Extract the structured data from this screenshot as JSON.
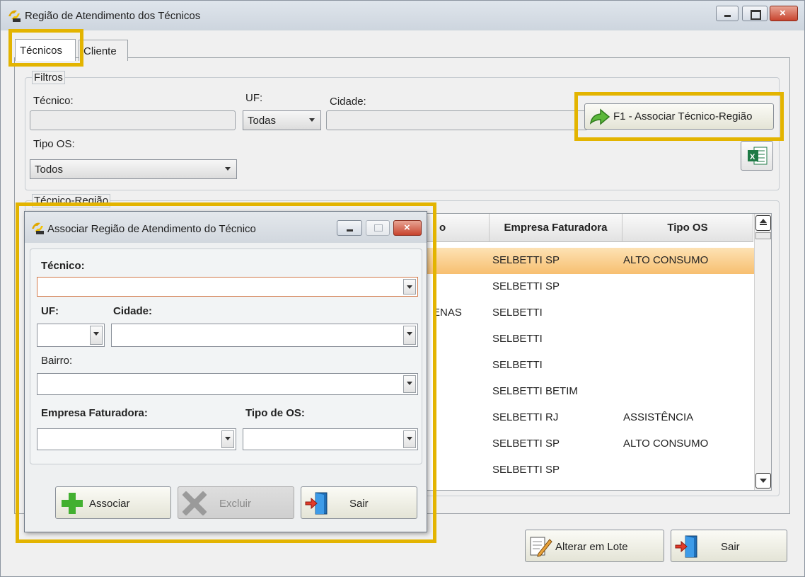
{
  "window": {
    "title": "Região de Atendimento dos Técnicos"
  },
  "tabs": [
    {
      "label": "Técnicos"
    },
    {
      "label": "Cliente"
    }
  ],
  "filters": {
    "legend": "Filtros",
    "tecnico_label": "Técnico:",
    "uf_label": "UF:",
    "uf_value": "Todas",
    "cidade_label": "Cidade:",
    "tipo_os_label": "Tipo OS:",
    "tipo_os_value": "Todos",
    "associate_button": "F1 - Associar Técnico-Região"
  },
  "region_group": {
    "legend": "Técnico-Região"
  },
  "grid": {
    "columns": {
      "partial": "o",
      "empresa": "Empresa Faturadora",
      "tipo": "Tipo OS"
    },
    "rows": [
      {
        "partial": "",
        "empresa": "SELBETTI SP",
        "tipo": "ALTO CONSUMO",
        "selected": true
      },
      {
        "partial": "",
        "empresa": "SELBETTI SP",
        "tipo": ""
      },
      {
        "partial": "ENAS",
        "empresa": "SELBETTI",
        "tipo": ""
      },
      {
        "partial": "",
        "empresa": "SELBETTI",
        "tipo": ""
      },
      {
        "partial": "",
        "empresa": "SELBETTI",
        "tipo": ""
      },
      {
        "partial": "",
        "empresa": "SELBETTI BETIM",
        "tipo": ""
      },
      {
        "partial": "",
        "empresa": "SELBETTI RJ",
        "tipo": "ASSISTÊNCIA"
      },
      {
        "partial": "",
        "empresa": "SELBETTI SP",
        "tipo": "ALTO CONSUMO"
      },
      {
        "partial": "",
        "empresa": "SELBETTI SP",
        "tipo": ""
      }
    ]
  },
  "footer": {
    "alterar_lote": "Alterar em Lote",
    "sair": "Sair"
  },
  "dialog": {
    "title": "Associar Região de Atendimento do Técnico",
    "tecnico_label": "Técnico:",
    "uf_label": "UF:",
    "cidade_label": "Cidade:",
    "bairro_label": "Bairro:",
    "empresa_label": "Empresa Faturadora:",
    "tipo_os_label": "Tipo de OS:",
    "associar": "Associar",
    "excluir": "Excluir",
    "sair": "Sair"
  },
  "colors": {
    "highlight": "#e3b400",
    "selected_row": "#f7bf70"
  }
}
